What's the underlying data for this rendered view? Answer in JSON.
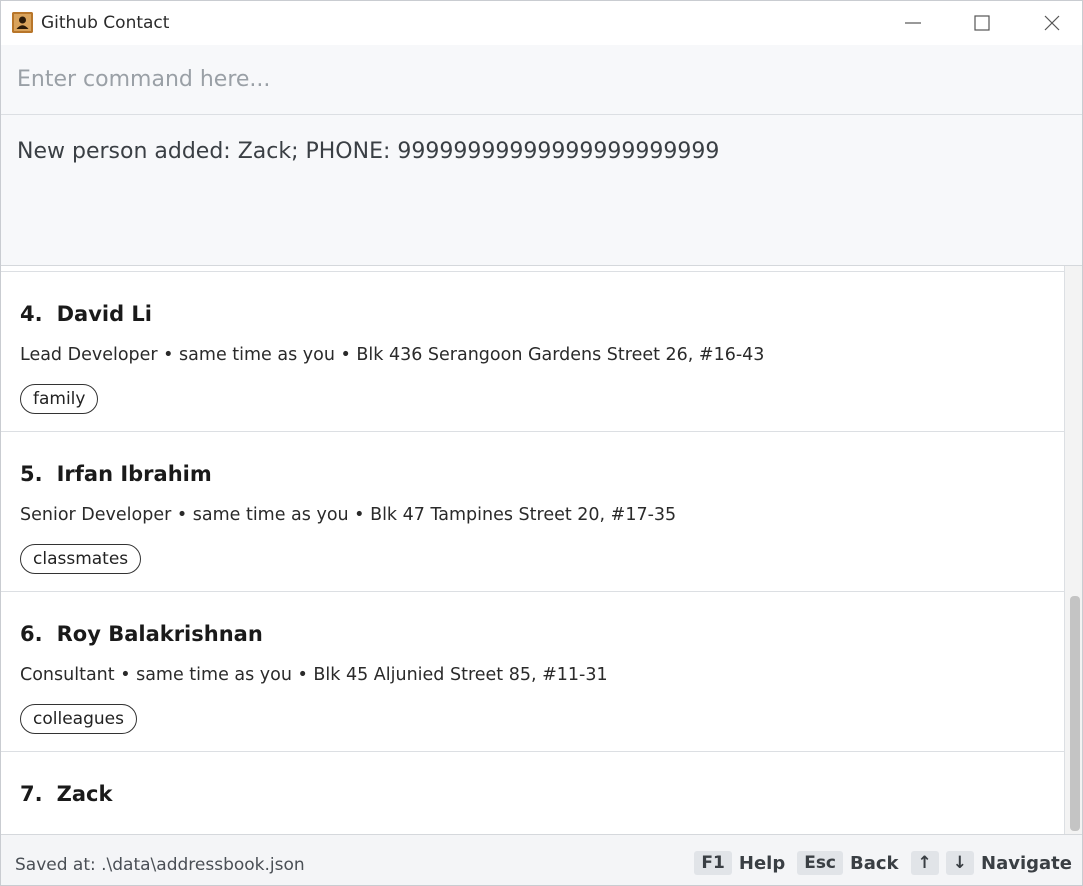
{
  "window": {
    "title": "Github Contact"
  },
  "command": {
    "placeholder": "Enter command here...",
    "value": ""
  },
  "result": {
    "message": "New person added: Zack; PHONE: 99999999999999999999999"
  },
  "persons": [
    {
      "index": "4.",
      "name": "David Li",
      "details": "Lead Developer • same time as you • Blk 436 Serangoon Gardens Street 26, #16-43",
      "tags": [
        "family"
      ]
    },
    {
      "index": "5.",
      "name": "Irfan Ibrahim",
      "details": "Senior Developer • same time as you • Blk 47 Tampines Street 20, #17-35",
      "tags": [
        "classmates"
      ]
    },
    {
      "index": "6.",
      "name": "Roy Balakrishnan",
      "details": "Consultant • same time as you • Blk 45 Aljunied Street 85, #11-31",
      "tags": [
        "colleagues"
      ]
    },
    {
      "index": "7.",
      "name": "Zack",
      "details": "",
      "tags": []
    }
  ],
  "statusbar": {
    "save_location": "Saved at: .\\data\\addressbook.json",
    "hints": [
      {
        "key": "F1",
        "label": "Help"
      },
      {
        "key": "Esc",
        "label": "Back"
      },
      {
        "key": "↑",
        "label": ""
      },
      {
        "key": "↓",
        "label": "Navigate"
      }
    ]
  },
  "icons": {
    "app": "contact-book-icon",
    "minimize": "minimize-icon",
    "maximize": "maximize-icon",
    "close": "close-icon"
  }
}
